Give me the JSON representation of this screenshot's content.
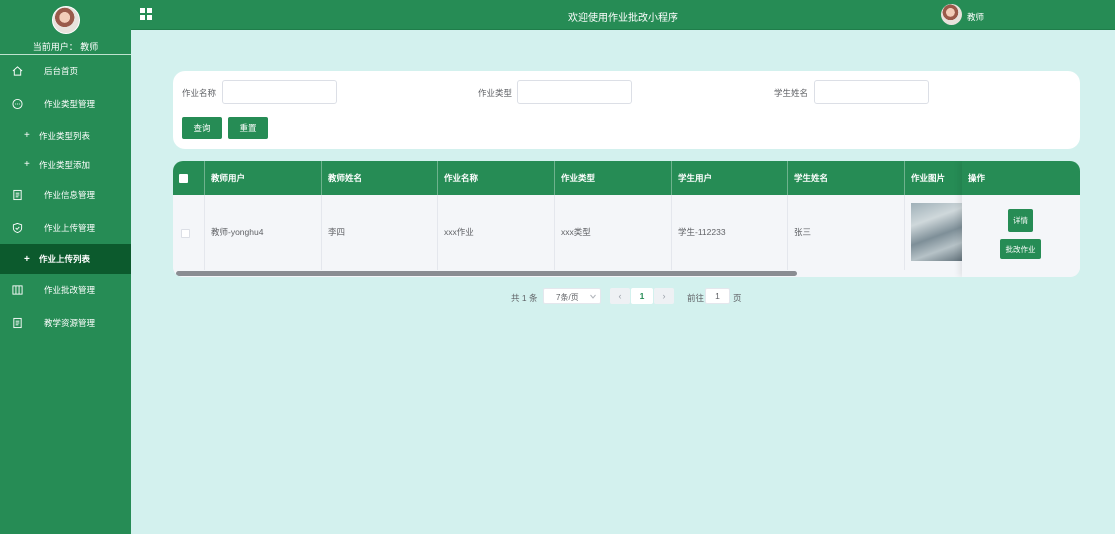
{
  "sidebar": {
    "current_user": "当前用户：  教师",
    "items": [
      {
        "label": "后台首页",
        "icon": "home-icon"
      },
      {
        "label": "作业类型管理",
        "icon": "chat-icon"
      },
      {
        "label": "作业类型列表",
        "sub": true
      },
      {
        "label": "作业类型添加",
        "sub": true
      },
      {
        "label": "作业信息管理",
        "icon": "document-icon"
      },
      {
        "label": "作业上传管理",
        "icon": "shield-icon"
      },
      {
        "label": "作业上传列表",
        "sub": true,
        "active": true
      },
      {
        "label": "作业批改管理",
        "icon": "columns-icon"
      },
      {
        "label": "教学资源管理",
        "icon": "document-icon"
      }
    ]
  },
  "topbar": {
    "title": "欢迎使用作业批改小程序",
    "user": "教师"
  },
  "search": {
    "field1_label": "作业名称",
    "field2_label": "作业类型",
    "field3_label": "学生姓名",
    "field1_value": "",
    "field2_value": "",
    "field3_value": "",
    "query_label": "查询",
    "reset_label": "重置"
  },
  "table": {
    "headers": [
      "教师用户",
      "教师姓名",
      "作业名称",
      "作业类型",
      "学生用户",
      "学生姓名",
      "作业图片",
      "操作"
    ],
    "rows": [
      [
        "教师-yonghu4",
        "李四",
        "xxx作业",
        "xxx类型",
        "学生-112233",
        "张三"
      ]
    ],
    "detail_label": "详情",
    "grade_label": "批改作业"
  },
  "pagination": {
    "total": "共 1 条",
    "page_size": "7条/页",
    "prev": "‹",
    "current": "1",
    "next": "›",
    "goto_label": "前往",
    "goto_value": "1",
    "page_suffix": "页"
  },
  "colors": {
    "primary": "#268c55",
    "active_menu": "#0c5a2d",
    "background": "#d3f1ee"
  }
}
